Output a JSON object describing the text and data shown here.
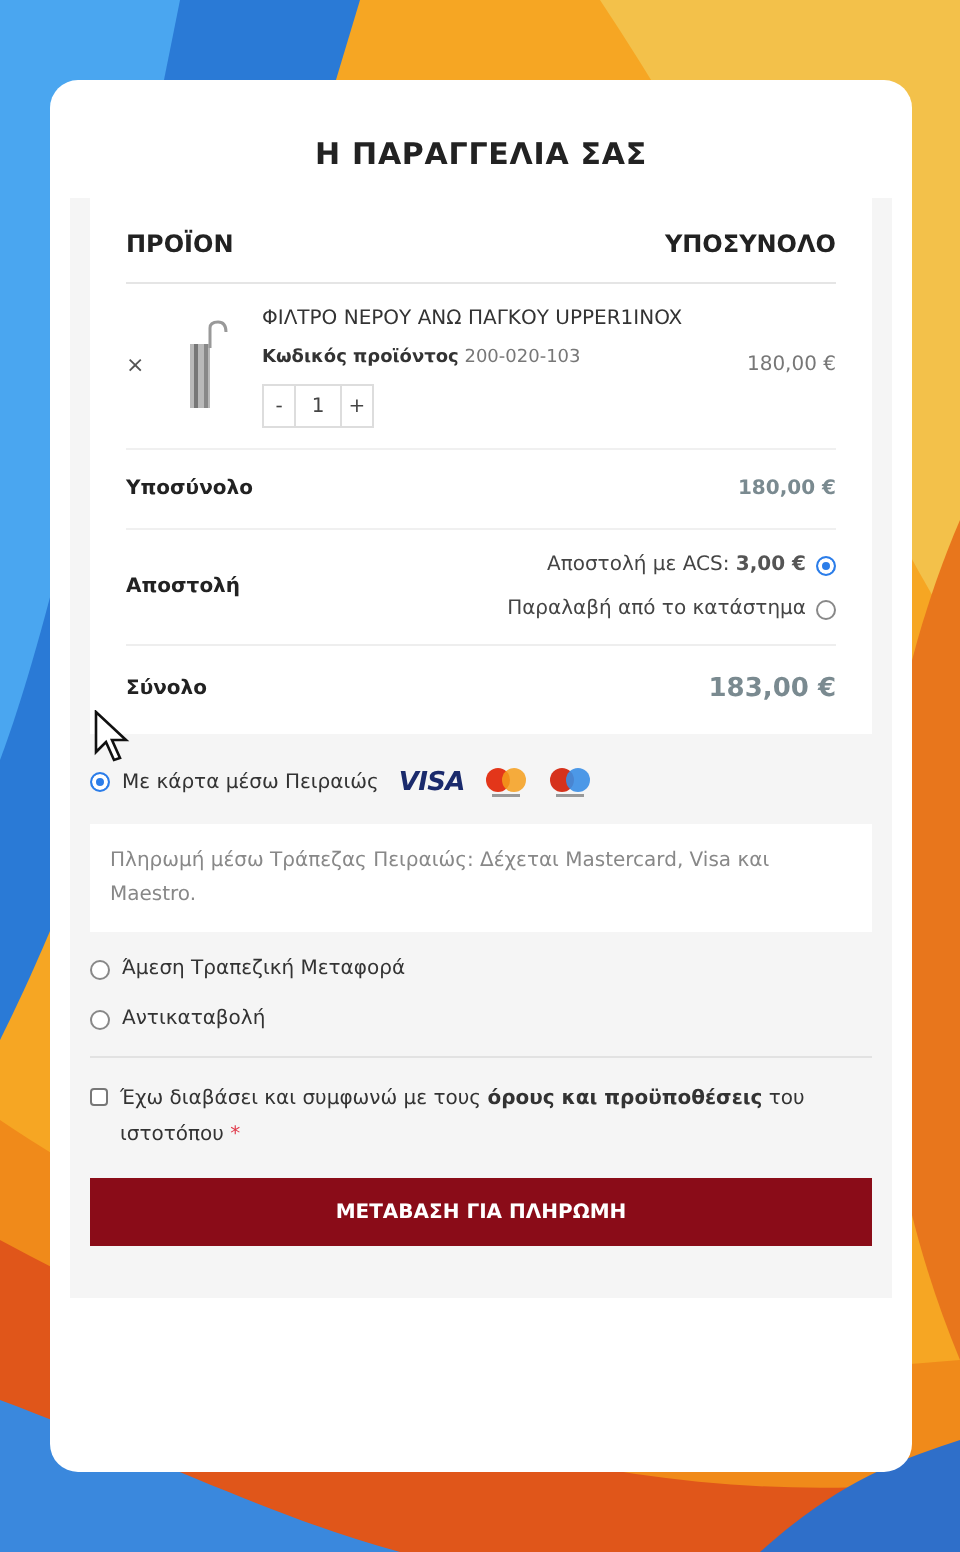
{
  "title": "Η ΠΑΡΑΓΓΕΛΙΑ ΣΑΣ",
  "table": {
    "columns": [
      "ΠΡΟΪΟΝ",
      "ΥΠΟΣΥΝΟΛΟ"
    ],
    "items": [
      {
        "remove": "×",
        "name": "ΦΙΛΤΡΟ ΝΕΡΟΥ ΑΝΩ ΠΑΓΚΟΥ UPPER1INOX",
        "sku_label": "Κωδικός προϊόντος",
        "sku": "200-020-103",
        "minus": "-",
        "quantity": "1",
        "plus": "+",
        "subtotal": "180,00 €"
      }
    ],
    "subtotal": {
      "label": "Υποσύνολο",
      "value": "180,00 €"
    },
    "shipping": {
      "label": "Αποστολή",
      "options": [
        {
          "label": "Αποστολή με ACS:",
          "price": "3,00 €",
          "selected": true
        },
        {
          "label": "Παραλαβή από το κατάστημα",
          "selected": false
        }
      ]
    },
    "total": {
      "label": "Σύνολο",
      "value": "183,00 €"
    }
  },
  "payment_methods": [
    {
      "label": "Με κάρτα μέσω Πειραιώς",
      "selected": true,
      "cards": true,
      "brand": "VISA",
      "description": "Πληρωμή μέσω Τράπεζας Πειραιώς: Δέχεται Mastercard, Visa και Maestro."
    },
    {
      "label": "Άμεση Τραπεζική Μεταφορά",
      "selected": false,
      "cards": false
    },
    {
      "label": "Αντικαταβολή",
      "selected": false,
      "cards": false
    }
  ],
  "terms": {
    "checked": false,
    "text": "Έχω διαβάσει και συμφωνώ με τους **όρους και προϋποθέσεις** του ιστοτόπου",
    "required_mark": "*"
  },
  "submit": "ΜΕΤΑΒΑΣΗ ΓΙΑ ΠΛΗΡΩΜΗ"
}
